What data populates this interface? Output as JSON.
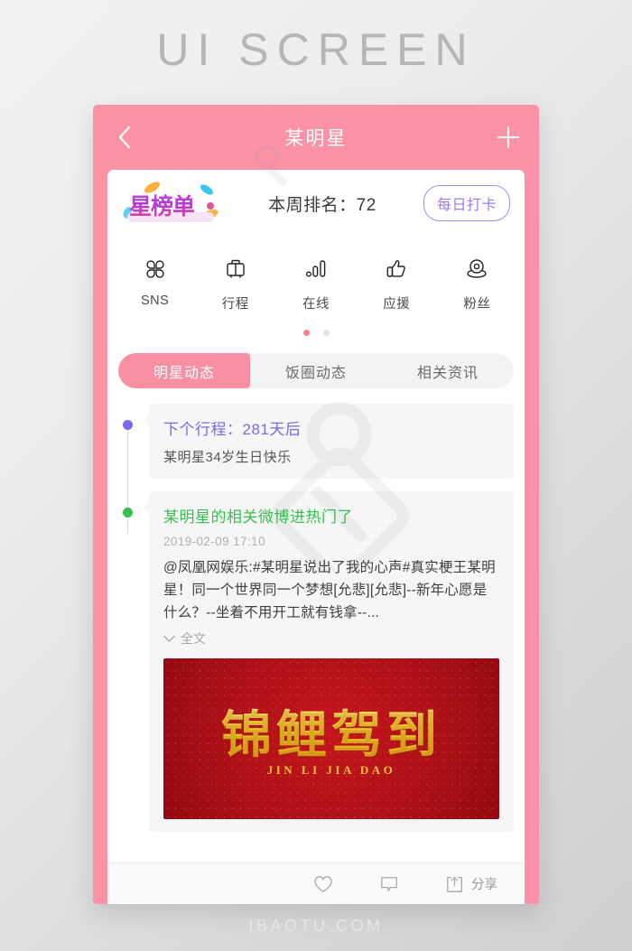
{
  "poster": {
    "title": "UI SCREEN",
    "watermark": "IBAOTU.COM"
  },
  "colors": {
    "brand_pink": "#FB92A6",
    "tab_active": "#FA8FA4",
    "checkin_purple": "#9B7BEE",
    "dot_purple": "#7B68EE",
    "dot_green": "#35C04F",
    "dot_active": "#FA7F95",
    "dot_inactive": "#E3E3E3",
    "image_red": "#C4151B",
    "image_gold": "#F2C52C"
  },
  "navbar": {
    "title": "某明星",
    "back_icon": "chevron-left-icon",
    "add_icon": "plus-icon"
  },
  "rank_row": {
    "logo_text": "星榜单",
    "rank_label": "本周排名：72",
    "checkin_label": "每日打卡"
  },
  "icon_grid": {
    "items": [
      {
        "label": "SNS",
        "icon": "four-leaf-grid-icon"
      },
      {
        "label": "行程",
        "icon": "suitcase-icon"
      },
      {
        "label": "在线",
        "icon": "bar-chart-icon"
      },
      {
        "label": "应援",
        "icon": "thumbs-up-icon"
      },
      {
        "label": "粉丝",
        "icon": "location-pin-icon"
      }
    ],
    "pager": {
      "total": 2,
      "active_index": 0
    }
  },
  "tabs": {
    "items": [
      {
        "label": "明星动态",
        "active": true
      },
      {
        "label": "饭圈动态",
        "active": false
      },
      {
        "label": "相关资讯",
        "active": false
      }
    ]
  },
  "feed": {
    "items": [
      {
        "dot_color": "#7B68EE",
        "title": "下个行程：281天后",
        "subtitle": "某明星34岁生日快乐"
      },
      {
        "dot_color": "#35C04F",
        "title": "某明星的相关微博进热门了",
        "time": "2019-02-09 17:10",
        "body": "@凤凰网娱乐:#某明星说出了我的心声#真实梗王某明星！同一个世界同一个梦想[允悲][允悲]--新年心愿是什么？--坐着不用开工就有钱拿--...",
        "more_label": "全文",
        "more_icon": "chevron-down-icon",
        "image": {
          "headline": "锦鲤驾到",
          "pinyin": "JIN LI JIA DAO"
        }
      }
    ]
  },
  "action_bar": {
    "items": [
      {
        "icon": "heart-icon",
        "label": ""
      },
      {
        "icon": "comment-icon",
        "label": ""
      },
      {
        "icon": "share-icon",
        "label": "分享"
      }
    ]
  }
}
